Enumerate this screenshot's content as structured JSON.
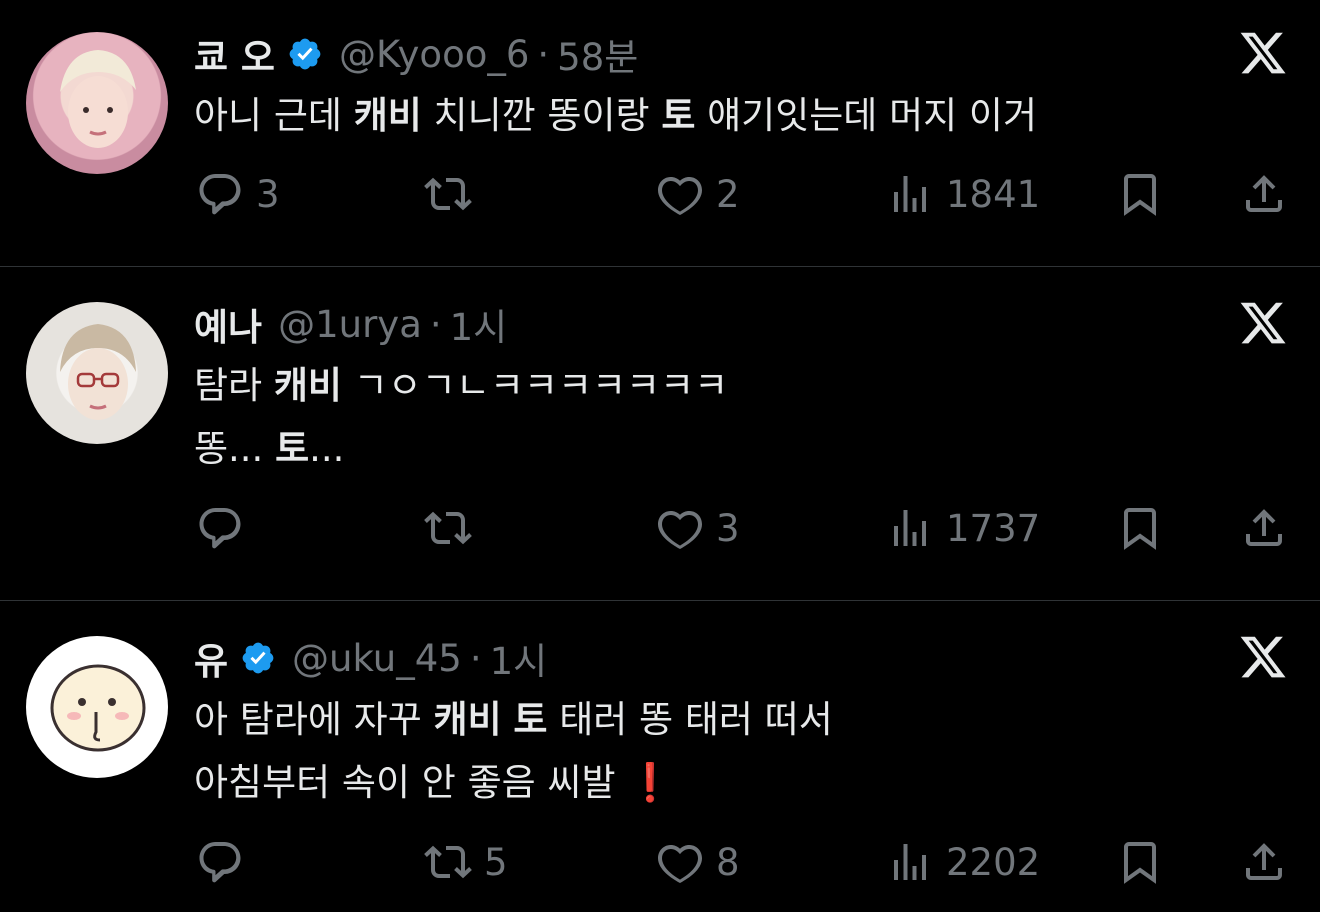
{
  "tweets": [
    {
      "name": "쿄 오",
      "verified": true,
      "handle": "@Kyooo_6",
      "time": "58분",
      "lines": [
        [
          {
            "t": "아니 근데 ",
            "b": false
          },
          {
            "t": "캐비",
            "b": true
          },
          {
            "t": " 치니깐 똥이랑 ",
            "b": false
          },
          {
            "t": "토",
            "b": true
          },
          {
            "t": " 얘기잇는데 머지 이거",
            "b": false
          }
        ]
      ],
      "replies": "3",
      "retweets": "",
      "likes": "2",
      "views": "1841"
    },
    {
      "name": "예나",
      "verified": false,
      "handle": "@1urya",
      "time": "1시",
      "lines": [
        [
          {
            "t": "탐라 ",
            "b": false
          },
          {
            "t": "캐비",
            "b": true
          },
          {
            "t": " ㄱㅇㄱㄴㅋㅋㅋㅋㅋㅋㅋ",
            "b": false
          }
        ],
        [
          {
            "t": "똥... ",
            "b": false
          },
          {
            "t": "토",
            "b": true
          },
          {
            "t": "...",
            "b": false
          }
        ]
      ],
      "replies": "",
      "retweets": "",
      "likes": "3",
      "views": "1737"
    },
    {
      "name": "유",
      "verified": true,
      "handle": "@uku_45",
      "time": "1시",
      "lines": [
        [
          {
            "t": "아 탐라에 자꾸 ",
            "b": false
          },
          {
            "t": "캐비",
            "b": true
          },
          {
            "t": " ",
            "b": false
          },
          {
            "t": "토",
            "b": true
          },
          {
            "t": " 태러 똥 태러 떠서",
            "b": false
          }
        ],
        [
          {
            "t": "아침부터 속이 안 좋음 씨발 ",
            "b": false
          },
          {
            "t": "❗",
            "b": false,
            "excl": true
          }
        ]
      ],
      "replies": "",
      "retweets": "5",
      "likes": "8",
      "views": "2202"
    }
  ],
  "colors": {
    "background": "#000000",
    "text": "#e7e9ea",
    "muted": "#71767b",
    "verified": "#1d9bf0",
    "divider": "#2f3336"
  },
  "icons": {
    "reply": "reply-icon",
    "retweet": "retweet-icon",
    "like": "like-icon",
    "views": "views-icon",
    "bookmark": "bookmark-icon",
    "share": "share-icon",
    "brand": "x-logo-icon"
  }
}
